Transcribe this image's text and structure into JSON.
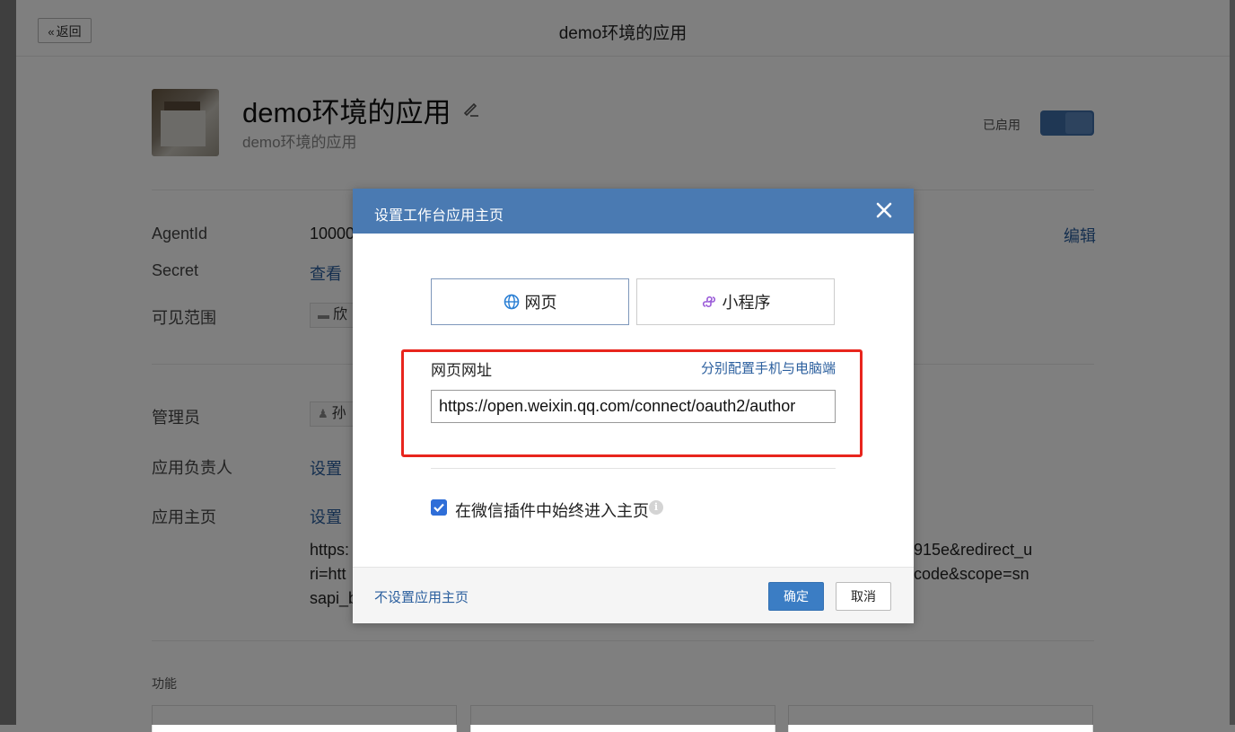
{
  "topbar": {
    "back_label": "返回",
    "title": "demo环境的应用"
  },
  "app": {
    "name": "demo环境的应用",
    "description": "demo环境的应用",
    "status_label": "已启用"
  },
  "info": {
    "agentid_label": "AgentId",
    "agentid_value": "10000",
    "secret_label": "Secret",
    "secret_view": "查看",
    "visible_label": "可见范围",
    "visible_value": "欣",
    "edit_link": "编辑",
    "admin_label": "管理员",
    "admin_value": "孙",
    "owner_label": "应用负责人",
    "owner_set": "设置",
    "homepage_label": "应用主页",
    "homepage_set": "设置",
    "url_left": [
      "https:",
      "ri=htt",
      "sapi_b"
    ],
    "url_right": [
      "915e&redirect_u",
      "code&scope=sn"
    ]
  },
  "features": {
    "title": "功能"
  },
  "dialog": {
    "title": "设置工作台应用主页",
    "tab_web": "网页",
    "tab_miniprogram": "小程序",
    "field_label": "网页网址",
    "field_link": "分别配置手机与电脑端",
    "url_value": "https://open.weixin.qq.com/connect/oauth2/author",
    "checkbox_label": "在微信插件中始终进入主页",
    "checkbox_checked": true,
    "no_homepage_link": "不设置应用主页",
    "ok_label": "确定",
    "cancel_label": "取消"
  },
  "colors": {
    "header": "#4a7ab2",
    "accent": "#3b7dc4",
    "highlight": "#e8251d",
    "link": "#2b5f9e"
  }
}
